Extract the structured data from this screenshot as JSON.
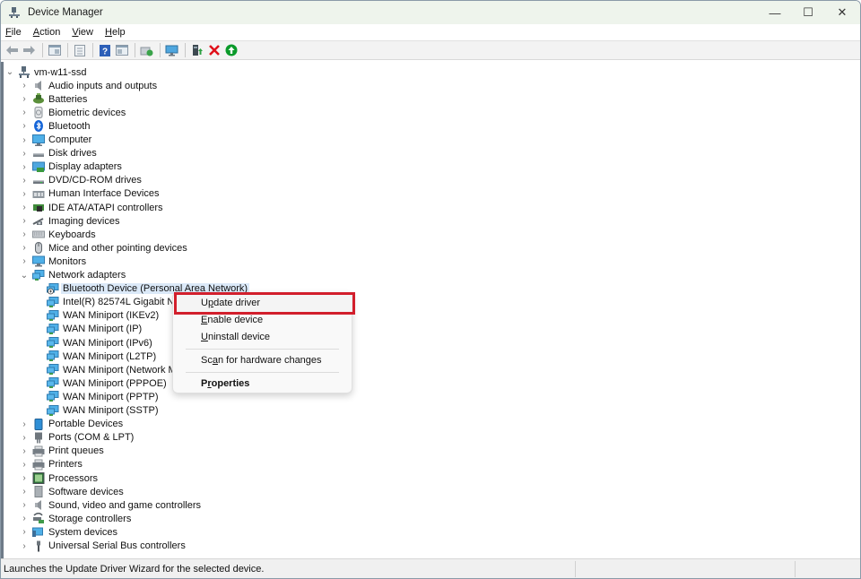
{
  "window": {
    "title": "Device Manager",
    "controls": {
      "minimize": "—",
      "maximize": "☐",
      "close": "✕"
    }
  },
  "menubar": {
    "items": [
      {
        "label": "File",
        "accel": "F",
        "rest": "ile"
      },
      {
        "label": "Action",
        "accel": "A",
        "rest": "ction"
      },
      {
        "label": "View",
        "accel": "V",
        "rest": "iew"
      },
      {
        "label": "Help",
        "accel": "H",
        "rest": "elp"
      }
    ]
  },
  "toolbar": {
    "buttons": [
      {
        "name": "back",
        "icon": "arrow-left-icon"
      },
      {
        "name": "forward",
        "icon": "arrow-right-icon"
      },
      {
        "name": "show-hide-console-tree",
        "icon": "console-tree-icon"
      },
      {
        "name": "properties",
        "icon": "properties-icon"
      },
      {
        "name": "help",
        "icon": "help-icon"
      },
      {
        "name": "show-hide-action-pane",
        "icon": "action-pane-icon"
      },
      {
        "name": "scan-hardware",
        "icon": "scan-hardware-icon"
      },
      {
        "name": "monitor",
        "icon": "monitor-icon"
      },
      {
        "name": "update-driver",
        "icon": "update-driver-icon"
      },
      {
        "name": "uninstall",
        "icon": "uninstall-x-icon"
      },
      {
        "name": "enable-device",
        "icon": "enable-arrow-icon"
      }
    ]
  },
  "tree": {
    "root": {
      "label": "vm-w11-ssd",
      "icon": "computer-network-icon",
      "expanded": true
    },
    "categories": [
      {
        "label": "Audio inputs and outputs",
        "icon": "speaker-icon"
      },
      {
        "label": "Batteries",
        "icon": "battery-icon"
      },
      {
        "label": "Biometric devices",
        "icon": "fingerprint-icon"
      },
      {
        "label": "Bluetooth",
        "icon": "bluetooth-icon"
      },
      {
        "label": "Computer",
        "icon": "computer-icon"
      },
      {
        "label": "Disk drives",
        "icon": "disk-drive-icon"
      },
      {
        "label": "Display adapters",
        "icon": "display-adapter-icon"
      },
      {
        "label": "DVD/CD-ROM drives",
        "icon": "dvd-drive-icon"
      },
      {
        "label": "Human Interface Devices",
        "icon": "hid-icon"
      },
      {
        "label": "IDE ATA/ATAPI controllers",
        "icon": "ide-controller-icon"
      },
      {
        "label": "Imaging devices",
        "icon": "camera-icon"
      },
      {
        "label": "Keyboards",
        "icon": "keyboard-icon"
      },
      {
        "label": "Mice and other pointing devices",
        "icon": "mouse-icon"
      },
      {
        "label": "Monitors",
        "icon": "monitor-icon"
      },
      {
        "label": "Network adapters",
        "icon": "network-adapter-icon",
        "expanded": true,
        "children": [
          {
            "label": "Bluetooth Device (Personal Area Network)",
            "selected": true
          },
          {
            "label": "Intel(R) 82574L Gigabit Network Connection"
          },
          {
            "label": "WAN Miniport (IKEv2)"
          },
          {
            "label": "WAN Miniport (IP)"
          },
          {
            "label": "WAN Miniport (IPv6)"
          },
          {
            "label": "WAN Miniport (L2TP)"
          },
          {
            "label": "WAN Miniport (Network Monitor)"
          },
          {
            "label": "WAN Miniport (PPPOE)"
          },
          {
            "label": "WAN Miniport (PPTP)"
          },
          {
            "label": "WAN Miniport (SSTP)"
          }
        ]
      },
      {
        "label": "Portable Devices",
        "icon": "portable-device-icon"
      },
      {
        "label": "Ports (COM & LPT)",
        "icon": "port-icon"
      },
      {
        "label": "Print queues",
        "icon": "printer-icon"
      },
      {
        "label": "Printers",
        "icon": "printer-icon"
      },
      {
        "label": "Processors",
        "icon": "processor-icon"
      },
      {
        "label": "Software devices",
        "icon": "software-device-icon"
      },
      {
        "label": "Sound, video and game controllers",
        "icon": "speaker-icon"
      },
      {
        "label": "Storage controllers",
        "icon": "storage-controller-icon"
      },
      {
        "label": "System devices",
        "icon": "system-device-icon"
      },
      {
        "label": "Universal Serial Bus controllers",
        "icon": "usb-icon"
      }
    ]
  },
  "context_menu": {
    "items": [
      {
        "pre": "U",
        "accel": "p",
        "post": "date driver",
        "label": "Update driver",
        "highlighted": true
      },
      {
        "pre": "",
        "accel": "E",
        "post": "nable device",
        "label": "Enable device"
      },
      {
        "pre": "",
        "accel": "U",
        "post": "ninstall device",
        "label": "Uninstall device"
      },
      {
        "separator": true
      },
      {
        "pre": "Sc",
        "accel": "a",
        "post": "n for hardware changes",
        "label": "Scan for hardware changes"
      },
      {
        "separator": true
      },
      {
        "pre": "P",
        "accel": "r",
        "post": "operties",
        "label": "Properties",
        "bold": true
      }
    ]
  },
  "statusbar": {
    "text": "Launches the Update Driver Wizard for the selected device."
  },
  "colors": {
    "titlebar_bg": "#eef4ec",
    "selection_bg": "#dbe9f8",
    "highlight_border": "#d21f2c",
    "uninstall_red": "#e0101a",
    "enable_green": "#0a9a2a"
  }
}
